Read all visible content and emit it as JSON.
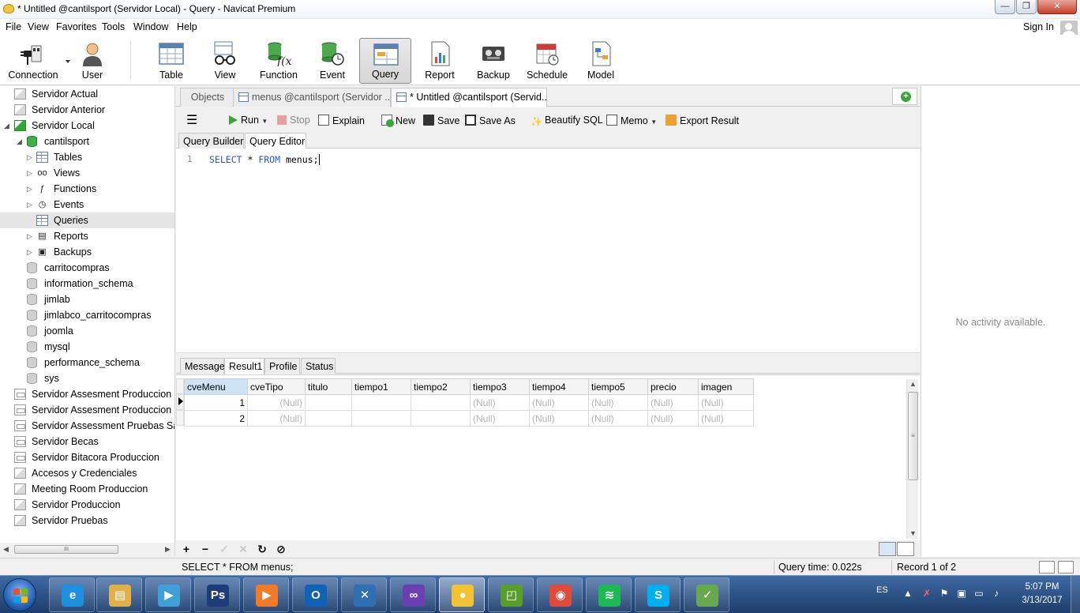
{
  "window": {
    "title": "* Untitled @cantilsport (Servidor Local) - Query - Navicat Premium",
    "min": "0",
    "max": "1",
    "close": "r"
  },
  "menu": [
    "File",
    "View",
    "Favorites",
    "Tools",
    "Window",
    "Help"
  ],
  "signin": "Sign In",
  "toolbar": {
    "connection": "Connection",
    "user": "User",
    "table": "Table",
    "view": "View",
    "function": "Function",
    "event": "Event",
    "query": "Query",
    "report": "Report",
    "backup": "Backup",
    "schedule": "Schedule",
    "model": "Model",
    "active": "query"
  },
  "sidebar": {
    "items": [
      {
        "label": "Servidor Actual",
        "level": 0,
        "icon": "server-icon"
      },
      {
        "label": "Servidor Anterior",
        "level": 0,
        "icon": "server-icon"
      },
      {
        "label": "Servidor Local",
        "level": 0,
        "icon": "server-active-icon",
        "expanded": true
      },
      {
        "label": "cantilsport",
        "level": 1,
        "icon": "database-active-icon",
        "expanded": true
      },
      {
        "label": "Tables",
        "level": 2,
        "icon": "tables-icon"
      },
      {
        "label": "Views",
        "level": 2,
        "icon": "views-icon"
      },
      {
        "label": "Functions",
        "level": 2,
        "icon": "functions-icon"
      },
      {
        "label": "Events",
        "level": 2,
        "icon": "events-icon"
      },
      {
        "label": "Queries",
        "level": 2,
        "icon": "queries-icon",
        "selected": true
      },
      {
        "label": "Reports",
        "level": 2,
        "icon": "reports-icon"
      },
      {
        "label": "Backups",
        "level": 2,
        "icon": "backups-icon"
      },
      {
        "label": "carritocompras",
        "level": 1,
        "icon": "database-icon"
      },
      {
        "label": "information_schema",
        "level": 1,
        "icon": "database-icon"
      },
      {
        "label": "jimlab",
        "level": 1,
        "icon": "database-icon"
      },
      {
        "label": "jimlabco_carritocompras",
        "level": 1,
        "icon": "database-icon"
      },
      {
        "label": "joomla",
        "level": 1,
        "icon": "database-icon"
      },
      {
        "label": "mysql",
        "level": 1,
        "icon": "database-icon"
      },
      {
        "label": "performance_schema",
        "level": 1,
        "icon": "database-icon"
      },
      {
        "label": "sys",
        "level": 1,
        "icon": "database-icon"
      },
      {
        "label": "Servidor Assesment Produccion Ci",
        "level": 0,
        "icon": "server-plain-icon"
      },
      {
        "label": "Servidor Assesment Produccion Sa",
        "level": 0,
        "icon": "server-plain-icon"
      },
      {
        "label": "Servidor Assessment Pruebas Santa",
        "level": 0,
        "icon": "server-plain-icon"
      },
      {
        "label": "Servidor Becas",
        "level": 0,
        "icon": "server-plain-icon"
      },
      {
        "label": "Servidor Bitacora Produccion",
        "level": 0,
        "icon": "server-plain-icon"
      },
      {
        "label": "Accesos y Credenciales",
        "level": 0,
        "icon": "server-icon"
      },
      {
        "label": "Meeting Room Produccion",
        "level": 0,
        "icon": "server-icon"
      },
      {
        "label": "Servidor Produccion",
        "level": 0,
        "icon": "server-icon"
      },
      {
        "label": "Servidor Pruebas",
        "level": 0,
        "icon": "server-icon"
      }
    ],
    "hscroll_grip": "III"
  },
  "tabs": {
    "objects": "Objects",
    "menus": "menus @cantilsport (Servidor ...",
    "untitled": "* Untitled @cantilsport (Servid..."
  },
  "qtoolbar": {
    "run": "Run",
    "stop": "Stop",
    "explain": "Explain",
    "new": "New",
    "save": "Save",
    "save_as": "Save As",
    "beautify": "Beautify SQL",
    "memo": "Memo",
    "export": "Export Result"
  },
  "editor_tabs": {
    "builder": "Query Builder",
    "editor": "Query Editor"
  },
  "editor": {
    "line_number": "1",
    "kw_select": "SELECT",
    "star": " * ",
    "kw_from": "FROM",
    "rest": " menus;"
  },
  "result_tabs": {
    "message": "Message",
    "result1": "Result1",
    "profile": "Profile",
    "status": "Status"
  },
  "grid": {
    "columns": [
      "cveMenu",
      "cveTipo",
      "titulo",
      "tiempo1",
      "tiempo2",
      "tiempo3",
      "tiempo4",
      "tiempo5",
      "precio",
      "imagen"
    ],
    "rows": [
      [
        "1",
        "(Null)",
        "",
        "",
        "",
        "(Null)",
        "(Null)",
        "(Null)",
        "(Null)",
        "(Null)"
      ],
      [
        "2",
        "(Null)",
        "",
        "",
        "",
        "(Null)",
        "(Null)",
        "(Null)",
        "(Null)",
        "(Null)"
      ]
    ]
  },
  "right_panel": {
    "empty": "No activity available."
  },
  "status": {
    "sql": "SELECT * FROM menus;",
    "query_time": "Query time: 0.022s",
    "record": "Record 1 of 2"
  },
  "taskbar": {
    "lang": "ES",
    "time": "5:07 PM",
    "date": "3/13/2017",
    "apps": [
      "internet-explorer-icon",
      "file-explorer-icon",
      "media-center-icon",
      "photoshop-icon",
      "media-player-icon",
      "outlook-icon",
      "tools-icon",
      "visual-studio-icon",
      "navicat-icon",
      "vsphere-icon",
      "chrome-icon",
      "spotify-icon",
      "skype-icon",
      "browser-icon"
    ],
    "app_glyphs": [
      "e",
      "▤",
      "▶",
      "Ps",
      "▶",
      "O",
      "✕",
      "∞",
      "●",
      "◰",
      "◉",
      "≋",
      "S",
      "✓"
    ],
    "app_colors": [
      "#1f8fe0",
      "#e2b04a",
      "#3fa0d8",
      "#1f3c7a",
      "#f07a25",
      "#1062b8",
      "#2f6fb3",
      "#6b3fb0",
      "#f1c232",
      "#5a9e2a",
      "#e04a3a",
      "#1db954",
      "#00aff0",
      "#6aa84f"
    ]
  },
  "colors": {
    "accent": "#2b57c8",
    "null_text": "#b4b4b4",
    "sorted_header": "#cfe3f7"
  }
}
